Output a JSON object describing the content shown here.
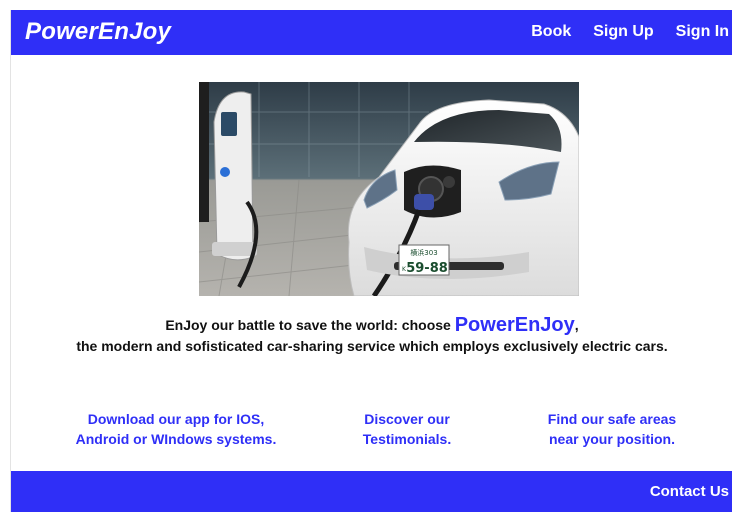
{
  "header": {
    "brand": "PowerEnJoy",
    "nav": [
      {
        "label": "Book"
      },
      {
        "label": "Sign Up"
      },
      {
        "label": "Sign In"
      }
    ]
  },
  "hero": {
    "plate_top": "横浜303",
    "plate_bottom": "59-88",
    "plate_prefix": "K",
    "charger_label": "e"
  },
  "tagline": {
    "line1_prefix": "EnJoy our battle to save the world: choose ",
    "brand": "PowerEnJoy",
    "line1_suffix": ",",
    "line2": "the modern and sofisticated car-sharing service which employs exclusively electric cars."
  },
  "links": [
    {
      "line1": "Download our app for IOS,",
      "line2": "Android or WIndows systems."
    },
    {
      "line1": "Discover our",
      "line2": "Testimonials."
    },
    {
      "line1": "Find our safe areas",
      "line2": "near your position."
    }
  ],
  "footer": {
    "contact": "Contact Us"
  },
  "colors": {
    "primary": "#2f2ff7",
    "text": "#111111",
    "background": "#ffffff"
  }
}
